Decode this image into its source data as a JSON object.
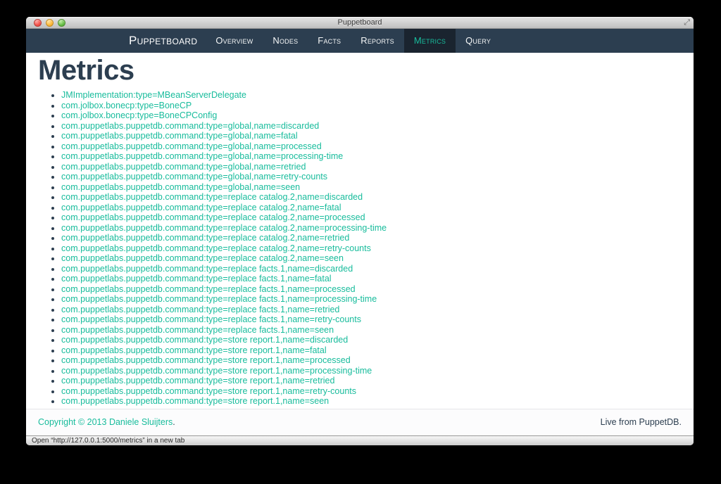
{
  "window": {
    "title": "Puppetboard"
  },
  "navbar": {
    "brand": "Puppetboard",
    "items": [
      {
        "label": "Overview",
        "active": false
      },
      {
        "label": "Nodes",
        "active": false
      },
      {
        "label": "Facts",
        "active": false
      },
      {
        "label": "Reports",
        "active": false
      },
      {
        "label": "Metrics",
        "active": true
      },
      {
        "label": "Query",
        "active": false
      }
    ]
  },
  "page": {
    "title": "Metrics",
    "metrics": [
      "JMImplementation:type=MBeanServerDelegate",
      "com.jolbox.bonecp:type=BoneCP",
      "com.jolbox.bonecp:type=BoneCPConfig",
      "com.puppetlabs.puppetdb.command:type=global,name=discarded",
      "com.puppetlabs.puppetdb.command:type=global,name=fatal",
      "com.puppetlabs.puppetdb.command:type=global,name=processed",
      "com.puppetlabs.puppetdb.command:type=global,name=processing-time",
      "com.puppetlabs.puppetdb.command:type=global,name=retried",
      "com.puppetlabs.puppetdb.command:type=global,name=retry-counts",
      "com.puppetlabs.puppetdb.command:type=global,name=seen",
      "com.puppetlabs.puppetdb.command:type=replace catalog.2,name=discarded",
      "com.puppetlabs.puppetdb.command:type=replace catalog.2,name=fatal",
      "com.puppetlabs.puppetdb.command:type=replace catalog.2,name=processed",
      "com.puppetlabs.puppetdb.command:type=replace catalog.2,name=processing-time",
      "com.puppetlabs.puppetdb.command:type=replace catalog.2,name=retried",
      "com.puppetlabs.puppetdb.command:type=replace catalog.2,name=retry-counts",
      "com.puppetlabs.puppetdb.command:type=replace catalog.2,name=seen",
      "com.puppetlabs.puppetdb.command:type=replace facts.1,name=discarded",
      "com.puppetlabs.puppetdb.command:type=replace facts.1,name=fatal",
      "com.puppetlabs.puppetdb.command:type=replace facts.1,name=processed",
      "com.puppetlabs.puppetdb.command:type=replace facts.1,name=processing-time",
      "com.puppetlabs.puppetdb.command:type=replace facts.1,name=retried",
      "com.puppetlabs.puppetdb.command:type=replace facts.1,name=retry-counts",
      "com.puppetlabs.puppetdb.command:type=replace facts.1,name=seen",
      "com.puppetlabs.puppetdb.command:type=store report.1,name=discarded",
      "com.puppetlabs.puppetdb.command:type=store report.1,name=fatal",
      "com.puppetlabs.puppetdb.command:type=store report.1,name=processed",
      "com.puppetlabs.puppetdb.command:type=store report.1,name=processing-time",
      "com.puppetlabs.puppetdb.command:type=store report.1,name=retried",
      "com.puppetlabs.puppetdb.command:type=store report.1,name=retry-counts",
      "com.puppetlabs.puppetdb.command:type=store report.1,name=seen"
    ]
  },
  "footer": {
    "copyright_prefix": "Copyright © 2013",
    "copyright_link": "Daniele Sluijters",
    "copyright_suffix": ".",
    "right_text": "Live from PuppetDB."
  },
  "status_bar": {
    "text": "Open “http://127.0.0.1:5000/metrics” in a new tab"
  },
  "icons": {
    "resize": "⤢"
  },
  "colors": {
    "accent": "#18bc9c",
    "navbar_bg": "#2c3e50",
    "navbar_active_bg": "#1a242f",
    "heading": "#2c3e50"
  }
}
